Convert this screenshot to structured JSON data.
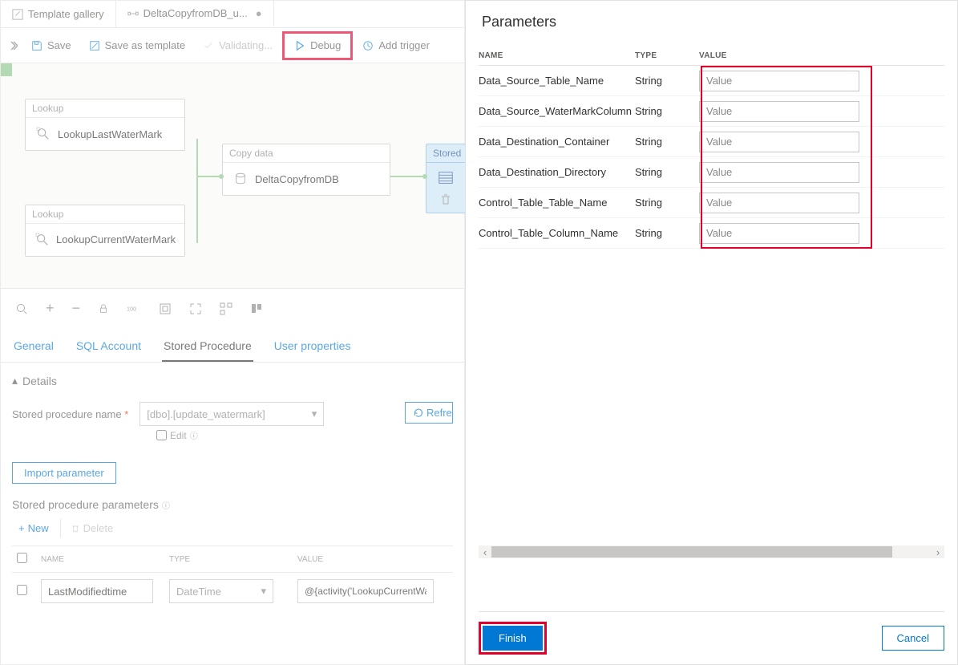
{
  "tabs": {
    "template_gallery": "Template gallery",
    "pipeline": "DeltaCopyfromDB_u..."
  },
  "toolbar": {
    "save": "Save",
    "save_as_template": "Save as template",
    "validating": "Validating...",
    "debug": "Debug",
    "add_trigger": "Add trigger"
  },
  "nodes": {
    "lookup_type": "Lookup",
    "lookup1": "LookupLastWaterMark",
    "lookup2": "LookupCurrentWaterMark",
    "copy_type": "Copy data",
    "copy": "DeltaCopyfromDB",
    "stored_type": "Stored"
  },
  "prop_tabs": {
    "general": "General",
    "sql": "SQL Account",
    "sp": "Stored Procedure",
    "user": "User properties"
  },
  "details": {
    "header": "Details",
    "sp_name_label": "Stored procedure name",
    "sp_name_value": "[dbo].[update_watermark]",
    "edit": "Edit",
    "refresh": "Refresh",
    "import_param": "Import parameter",
    "sp_params": "Stored procedure parameters",
    "new": "New",
    "delete": "Delete"
  },
  "sp_table": {
    "headers": {
      "name": "NAME",
      "type": "TYPE",
      "value": "VALUE"
    },
    "row": {
      "name": "LastModifiedtime",
      "type": "DateTime",
      "value": "@{activity('LookupCurrentWaterMut.firstRow.NewWatermarkValue}"
    }
  },
  "panel": {
    "title": "Parameters",
    "headers": {
      "name": "NAME",
      "type": "TYPE",
      "value": "VALUE"
    },
    "placeholder": "Value",
    "rows": [
      {
        "name": "Data_Source_Table_Name",
        "type": "String"
      },
      {
        "name": "Data_Source_WaterMarkColumn",
        "type": "String"
      },
      {
        "name": "Data_Destination_Container",
        "type": "String"
      },
      {
        "name": "Data_Destination_Directory",
        "type": "String"
      },
      {
        "name": "Control_Table_Table_Name",
        "type": "String"
      },
      {
        "name": "Control_Table_Column_Name",
        "type": "String"
      }
    ],
    "finish": "Finish",
    "cancel": "Cancel"
  }
}
